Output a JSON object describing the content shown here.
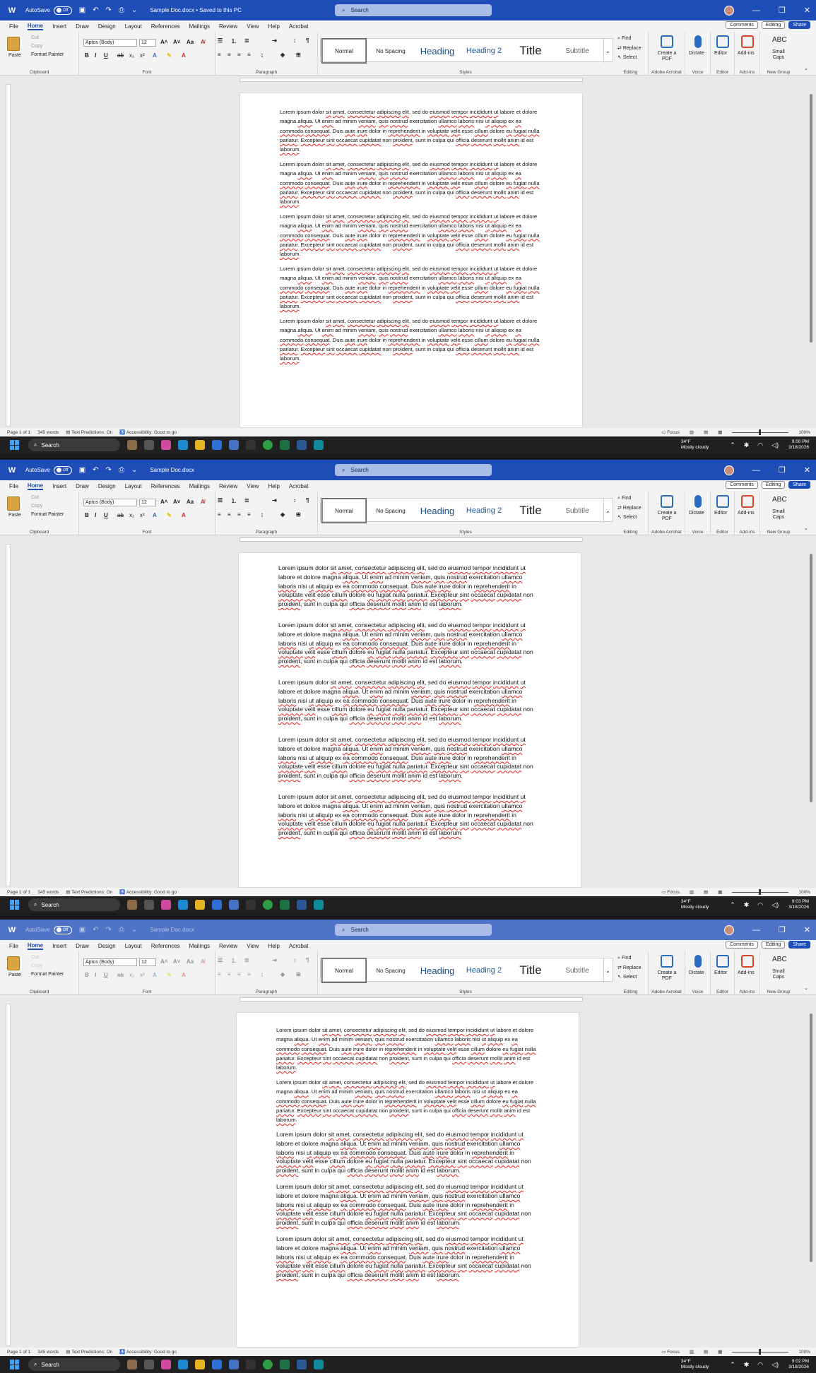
{
  "titlebar": {
    "autosave": "AutoSave",
    "toggle": "Off",
    "doc_title_1": "Sample Doc.docx • Saved to this PC",
    "doc_title_2": "Sample Doc.docx",
    "doc_title_3": "Sample Doc.docx",
    "search": "Search"
  },
  "menu": {
    "items": [
      "File",
      "Home",
      "Insert",
      "Draw",
      "Design",
      "Layout",
      "References",
      "Mailings",
      "Review",
      "View",
      "Help",
      "Acrobat"
    ],
    "comments": "Comments",
    "editing": "Editing",
    "share": "Share"
  },
  "ribbon": {
    "clipboard": {
      "paste": "Paste",
      "cut": "Cut",
      "copy": "Copy",
      "format_painter": "Format Painter",
      "label": "Clipboard"
    },
    "font": {
      "name": "Aptos (Body)",
      "size": "12",
      "label": "Font"
    },
    "paragraph": {
      "label": "Paragraph"
    },
    "styles": {
      "label": "Styles",
      "items": [
        "Normal",
        "No Spacing",
        "Heading",
        "Heading 2",
        "Title",
        "Subtitle"
      ]
    },
    "editing": {
      "find": "Find",
      "replace": "Replace",
      "select": "Select",
      "label": "Editing"
    },
    "acrobat": {
      "create": "Create a PDF",
      "label": "Adobe Acrobat"
    },
    "voice": {
      "dictate": "Dictate",
      "label": "Voice"
    },
    "editor": {
      "editor": "Editor",
      "label": "Editor"
    },
    "addins": {
      "addins": "Add-ins",
      "label": "Add-ins"
    },
    "newgroup": {
      "small_caps": "Small Caps",
      "label": "New Group"
    }
  },
  "document": {
    "paragraph_text": "Lorem ipsum dolor sit amet, consectetur adipiscing elit, sed do eiusmod tempor incididunt ut labore et dolore magna aliqua. Ut enim ad minim veniam, quis nostrud exercitation ullamco laboris nisi ut aliquip ex ea commodo consequat. Duis aute irure dolor in reprehenderit in voluptate velit esse cillum dolore eu fugiat nulla pariatur. Excepteur sint occaecat cupidatat non proident, sunt in culpa qui officia deserunt mollit anim id est laborum."
  },
  "status": {
    "page": "Page 1 of 1",
    "words": "345 words",
    "predictions": "Text Predictions: On",
    "accessibility": "Accessibility: Good to go",
    "focus": "Focus",
    "zoom": "100%"
  },
  "taskbar": {
    "search": "Search",
    "temp": "34°F",
    "weather": "Mostly cloudy",
    "time_1": "9:00 PM",
    "time_2": "9:03 PM",
    "time_3": "9:02 PM",
    "date": "3/18/2026"
  }
}
